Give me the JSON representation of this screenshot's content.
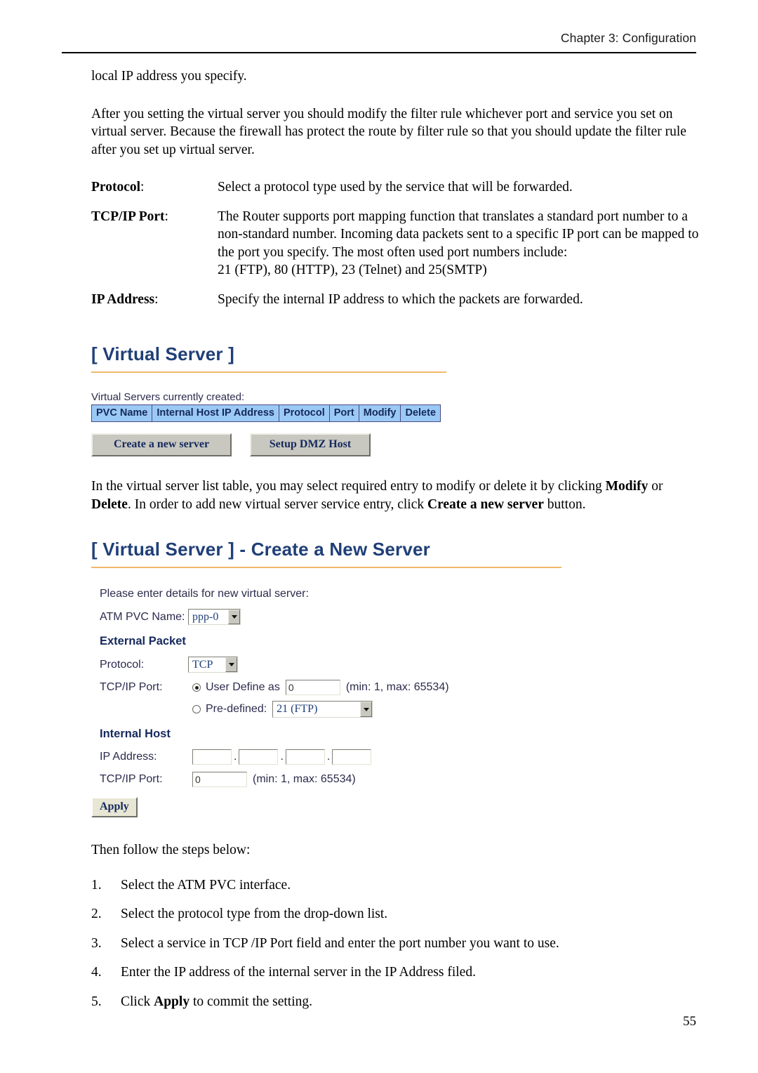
{
  "header": {
    "chapter": "Chapter 3: Configuration"
  },
  "intro": {
    "line1": "local IP address you specify.",
    "paragraph": "After you setting the virtual server you should modify the filter rule whichever port and service you set on virtual server. Because the firewall has protect the route by filter rule so that you should update the filter rule after you set up virtual server."
  },
  "definitions": [
    {
      "term": "Protocol",
      "term_suffix": ":",
      "desc": "Select a protocol type used by the service that will be forwarded."
    },
    {
      "term": "TCP/IP Port",
      "term_suffix": ":",
      "desc": "The Router supports port mapping function that translates a standard port number to a non-standard number. Incoming data packets sent to a specific IP port can be mapped to the port you specify. The most often used port numbers include:",
      "desc_line2": "21 (FTP), 80 (HTTP), 23 (Telnet) and 25(SMTP)"
    },
    {
      "term": "IP Address",
      "term_suffix": ":",
      "desc": "Specify the internal IP address to which the packets are forwarded."
    }
  ],
  "section_virtual_server": {
    "heading": "[ Virtual Server ]",
    "caption": "Virtual Servers currently created:",
    "table_headers": [
      "PVC Name",
      "Internal Host IP Address",
      "Protocol",
      "Port",
      "Modify",
      "Delete"
    ],
    "table_rows": [],
    "buttons": {
      "create": "Create a new server",
      "dmz": "Setup DMZ Host"
    }
  },
  "paragraph_after_table": {
    "part1": "In the virtual server list table, you may select required entry to modify or delete it by clicking ",
    "bold1": "Modify",
    "part2": " or ",
    "bold2": "Delete",
    "part3": ". In order to add new virtual server service entry, click ",
    "bold3": "Create a new server",
    "part4": " button."
  },
  "section_create_server": {
    "heading": "[ Virtual Server ] - Create a New Server",
    "lead": "Please enter details for new virtual server:",
    "atm_pvc_label": "ATM PVC Name:",
    "atm_pvc_value": "ppp-0",
    "external_packet_heading": "External Packet",
    "protocol_label": "Protocol:",
    "protocol_value": "TCP",
    "tcpip_port_label": "TCP/IP Port:",
    "user_define_label": "User Define as",
    "user_define_value": "0",
    "user_define_hint": "(min: 1, max: 65534)",
    "user_define_selected": true,
    "predefined_label": "Pre-defined:",
    "predefined_value": "21 (FTP)",
    "predefined_selected": false,
    "internal_host_heading": "Internal Host",
    "ip_address_label": "IP Address:",
    "ip_octets": [
      "",
      "",
      "",
      ""
    ],
    "ip_separator": ".",
    "internal_port_label": "TCP/IP Port:",
    "internal_port_value": "0",
    "internal_port_hint": "(min: 1, max: 65534)",
    "apply_label": "Apply"
  },
  "steps": {
    "lead": "Then follow the steps below:",
    "items": [
      {
        "num": "1.",
        "text": "Select the ATM PVC interface."
      },
      {
        "num": "2.",
        "text": "Select the protocol type from the drop-down list."
      },
      {
        "num": "3.",
        "text": "Select a service in TCP /IP Port field and enter the port number you want to use."
      },
      {
        "num": "4.",
        "text": "Enter the IP address of the internal server in the IP Address filed."
      },
      {
        "num": "5.",
        "text_before": "Click ",
        "bold": "Apply",
        "text_after": " to commit the setting."
      }
    ]
  },
  "footer": {
    "page_number": "55"
  },
  "colors": {
    "heading_blue": "#1f3f77",
    "heading_rule_orange": "#f2b96a",
    "table_header_bg": "#9bc9f5",
    "table_header_text": "#14295c",
    "button_face": "#c8c8c0",
    "apply_face": "#e8e6d4"
  }
}
